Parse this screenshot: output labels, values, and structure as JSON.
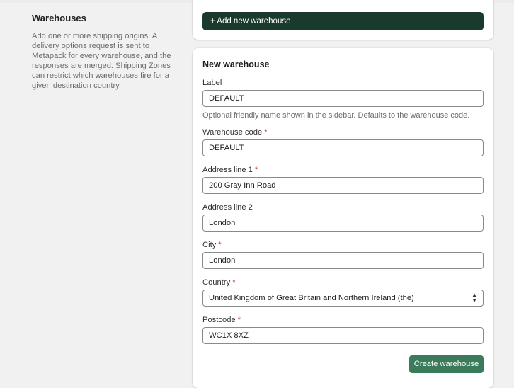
{
  "sidebar": {
    "title": "Warehouses",
    "description": "Add one or more shipping origins. A delivery options request is sent to Metapack for every warehouse, and the responses are merged. Shipping Zones can restrict which warehouses fire for a given destination country."
  },
  "top_card": {
    "add_button_label": "+ Add new warehouse"
  },
  "form": {
    "title": "New warehouse",
    "required_marker": "*",
    "fields": {
      "label": {
        "label": "Label",
        "value": "DEFAULT",
        "help": "Optional friendly name shown in the sidebar. Defaults to the warehouse code."
      },
      "warehouse_code": {
        "label": "Warehouse code",
        "value": "DEFAULT"
      },
      "address_line_1": {
        "label": "Address line 1",
        "value": "200 Gray Inn Road"
      },
      "address_line_2": {
        "label": "Address line 2",
        "value": "London"
      },
      "city": {
        "label": "City",
        "value": "London"
      },
      "country": {
        "label": "Country",
        "value": "United Kingdom of Great Britain and Northern Ireland (the)"
      },
      "postcode": {
        "label": "Postcode",
        "value": "WC1X 8XZ"
      }
    },
    "submit_label": "Create warehouse"
  },
  "colors": {
    "primary_dark": "#1a3a2d",
    "primary_button": "#3b7b5c",
    "required": "#c0392b",
    "background": "#f1f1f1"
  }
}
